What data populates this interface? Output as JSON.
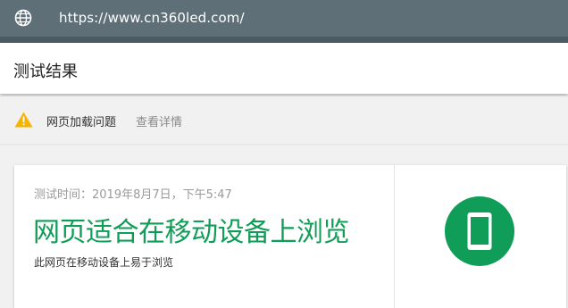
{
  "browser": {
    "url": "https://www.cn360led.com/",
    "icon": "globe-icon"
  },
  "page": {
    "title": "测试结果"
  },
  "issues": {
    "icon": "warning-icon",
    "label": "网页加载问题",
    "details_link": "查看详情"
  },
  "result": {
    "test_time": "测试时间：2019年8月7日，下午5:47",
    "verdict": "网页适合在移动设备上浏览",
    "subtitle": "此网页在移动设备上易于浏览",
    "icon": "mobile-phone-icon"
  },
  "colors": {
    "urlbar": "#5f6f78",
    "success": "#0f9d58",
    "warning": "#f4b400"
  }
}
